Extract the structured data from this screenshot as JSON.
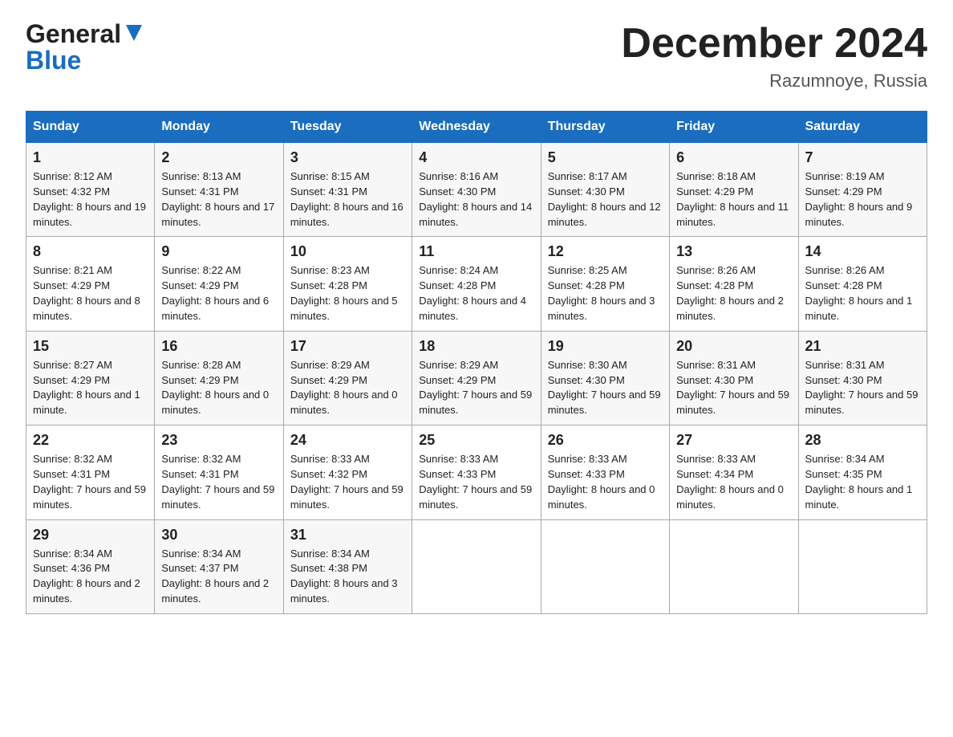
{
  "header": {
    "logo_line1": "General",
    "logo_line2": "Blue",
    "month_title": "December 2024",
    "location": "Razumnoye, Russia"
  },
  "days_of_week": [
    "Sunday",
    "Monday",
    "Tuesday",
    "Wednesday",
    "Thursday",
    "Friday",
    "Saturday"
  ],
  "weeks": [
    [
      {
        "num": "1",
        "sunrise": "Sunrise: 8:12 AM",
        "sunset": "Sunset: 4:32 PM",
        "daylight": "Daylight: 8 hours and 19 minutes."
      },
      {
        "num": "2",
        "sunrise": "Sunrise: 8:13 AM",
        "sunset": "Sunset: 4:31 PM",
        "daylight": "Daylight: 8 hours and 17 minutes."
      },
      {
        "num": "3",
        "sunrise": "Sunrise: 8:15 AM",
        "sunset": "Sunset: 4:31 PM",
        "daylight": "Daylight: 8 hours and 16 minutes."
      },
      {
        "num": "4",
        "sunrise": "Sunrise: 8:16 AM",
        "sunset": "Sunset: 4:30 PM",
        "daylight": "Daylight: 8 hours and 14 minutes."
      },
      {
        "num": "5",
        "sunrise": "Sunrise: 8:17 AM",
        "sunset": "Sunset: 4:30 PM",
        "daylight": "Daylight: 8 hours and 12 minutes."
      },
      {
        "num": "6",
        "sunrise": "Sunrise: 8:18 AM",
        "sunset": "Sunset: 4:29 PM",
        "daylight": "Daylight: 8 hours and 11 minutes."
      },
      {
        "num": "7",
        "sunrise": "Sunrise: 8:19 AM",
        "sunset": "Sunset: 4:29 PM",
        "daylight": "Daylight: 8 hours and 9 minutes."
      }
    ],
    [
      {
        "num": "8",
        "sunrise": "Sunrise: 8:21 AM",
        "sunset": "Sunset: 4:29 PM",
        "daylight": "Daylight: 8 hours and 8 minutes."
      },
      {
        "num": "9",
        "sunrise": "Sunrise: 8:22 AM",
        "sunset": "Sunset: 4:29 PM",
        "daylight": "Daylight: 8 hours and 6 minutes."
      },
      {
        "num": "10",
        "sunrise": "Sunrise: 8:23 AM",
        "sunset": "Sunset: 4:28 PM",
        "daylight": "Daylight: 8 hours and 5 minutes."
      },
      {
        "num": "11",
        "sunrise": "Sunrise: 8:24 AM",
        "sunset": "Sunset: 4:28 PM",
        "daylight": "Daylight: 8 hours and 4 minutes."
      },
      {
        "num": "12",
        "sunrise": "Sunrise: 8:25 AM",
        "sunset": "Sunset: 4:28 PM",
        "daylight": "Daylight: 8 hours and 3 minutes."
      },
      {
        "num": "13",
        "sunrise": "Sunrise: 8:26 AM",
        "sunset": "Sunset: 4:28 PM",
        "daylight": "Daylight: 8 hours and 2 minutes."
      },
      {
        "num": "14",
        "sunrise": "Sunrise: 8:26 AM",
        "sunset": "Sunset: 4:28 PM",
        "daylight": "Daylight: 8 hours and 1 minute."
      }
    ],
    [
      {
        "num": "15",
        "sunrise": "Sunrise: 8:27 AM",
        "sunset": "Sunset: 4:29 PM",
        "daylight": "Daylight: 8 hours and 1 minute."
      },
      {
        "num": "16",
        "sunrise": "Sunrise: 8:28 AM",
        "sunset": "Sunset: 4:29 PM",
        "daylight": "Daylight: 8 hours and 0 minutes."
      },
      {
        "num": "17",
        "sunrise": "Sunrise: 8:29 AM",
        "sunset": "Sunset: 4:29 PM",
        "daylight": "Daylight: 8 hours and 0 minutes."
      },
      {
        "num": "18",
        "sunrise": "Sunrise: 8:29 AM",
        "sunset": "Sunset: 4:29 PM",
        "daylight": "Daylight: 7 hours and 59 minutes."
      },
      {
        "num": "19",
        "sunrise": "Sunrise: 8:30 AM",
        "sunset": "Sunset: 4:30 PM",
        "daylight": "Daylight: 7 hours and 59 minutes."
      },
      {
        "num": "20",
        "sunrise": "Sunrise: 8:31 AM",
        "sunset": "Sunset: 4:30 PM",
        "daylight": "Daylight: 7 hours and 59 minutes."
      },
      {
        "num": "21",
        "sunrise": "Sunrise: 8:31 AM",
        "sunset": "Sunset: 4:30 PM",
        "daylight": "Daylight: 7 hours and 59 minutes."
      }
    ],
    [
      {
        "num": "22",
        "sunrise": "Sunrise: 8:32 AM",
        "sunset": "Sunset: 4:31 PM",
        "daylight": "Daylight: 7 hours and 59 minutes."
      },
      {
        "num": "23",
        "sunrise": "Sunrise: 8:32 AM",
        "sunset": "Sunset: 4:31 PM",
        "daylight": "Daylight: 7 hours and 59 minutes."
      },
      {
        "num": "24",
        "sunrise": "Sunrise: 8:33 AM",
        "sunset": "Sunset: 4:32 PM",
        "daylight": "Daylight: 7 hours and 59 minutes."
      },
      {
        "num": "25",
        "sunrise": "Sunrise: 8:33 AM",
        "sunset": "Sunset: 4:33 PM",
        "daylight": "Daylight: 7 hours and 59 minutes."
      },
      {
        "num": "26",
        "sunrise": "Sunrise: 8:33 AM",
        "sunset": "Sunset: 4:33 PM",
        "daylight": "Daylight: 8 hours and 0 minutes."
      },
      {
        "num": "27",
        "sunrise": "Sunrise: 8:33 AM",
        "sunset": "Sunset: 4:34 PM",
        "daylight": "Daylight: 8 hours and 0 minutes."
      },
      {
        "num": "28",
        "sunrise": "Sunrise: 8:34 AM",
        "sunset": "Sunset: 4:35 PM",
        "daylight": "Daylight: 8 hours and 1 minute."
      }
    ],
    [
      {
        "num": "29",
        "sunrise": "Sunrise: 8:34 AM",
        "sunset": "Sunset: 4:36 PM",
        "daylight": "Daylight: 8 hours and 2 minutes."
      },
      {
        "num": "30",
        "sunrise": "Sunrise: 8:34 AM",
        "sunset": "Sunset: 4:37 PM",
        "daylight": "Daylight: 8 hours and 2 minutes."
      },
      {
        "num": "31",
        "sunrise": "Sunrise: 8:34 AM",
        "sunset": "Sunset: 4:38 PM",
        "daylight": "Daylight: 8 hours and 3 minutes."
      },
      null,
      null,
      null,
      null
    ]
  ]
}
